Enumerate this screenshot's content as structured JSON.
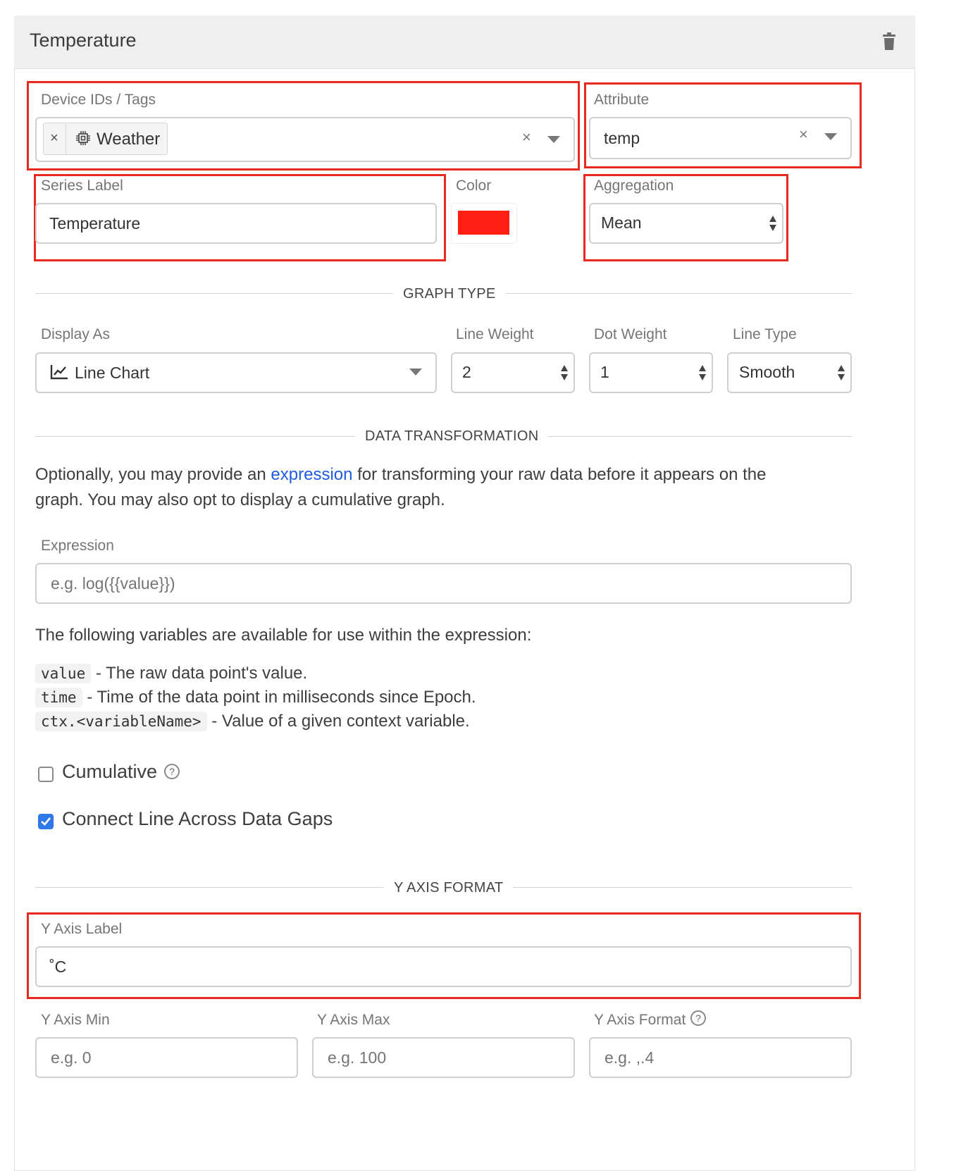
{
  "panel": {
    "title": "Temperature"
  },
  "fields": {
    "device": {
      "label": "Device IDs / Tags",
      "tag": "Weather"
    },
    "attribute": {
      "label": "Attribute",
      "value": "temp"
    },
    "series_label": {
      "label": "Series Label",
      "value": "Temperature"
    },
    "color": {
      "label": "Color",
      "value": "#ff1e12"
    },
    "aggregation": {
      "label": "Aggregation",
      "value": "Mean"
    }
  },
  "graph_type": {
    "title": "GRAPH TYPE",
    "display_as": {
      "label": "Display As",
      "value": "Line Chart"
    },
    "line_weight": {
      "label": "Line Weight",
      "value": "2"
    },
    "dot_weight": {
      "label": "Dot Weight",
      "value": "1"
    },
    "line_type": {
      "label": "Line Type",
      "value": "Smooth"
    }
  },
  "data_transformation": {
    "title": "DATA TRANSFORMATION",
    "intro_before": "Optionally, you may provide an ",
    "intro_link": "expression",
    "intro_after": " for transforming your raw data before it appears on the",
    "intro_line2": "graph. You may also opt to display a cumulative graph.",
    "expression": {
      "label": "Expression",
      "placeholder": "e.g. log({{value}})"
    },
    "vars_intro": "The following variables are available for use within the expression:",
    "vars": [
      {
        "code": "value",
        "desc": "- The raw data point's value."
      },
      {
        "code": "time",
        "desc": "- Time of the data point in milliseconds since Epoch."
      },
      {
        "code": "ctx.<variableName>",
        "desc": "- Value of a given context variable."
      }
    ],
    "cumulative": {
      "label": "Cumulative",
      "checked": false
    },
    "connect_gaps": {
      "label": "Connect Line Across Data Gaps",
      "checked": true
    }
  },
  "y_axis": {
    "title": "Y AXIS FORMAT",
    "label": {
      "label": "Y Axis Label",
      "value": "˚C"
    },
    "min": {
      "label": "Y Axis Min",
      "placeholder": "e.g. 0"
    },
    "max": {
      "label": "Y Axis Max",
      "placeholder": "e.g. 100"
    },
    "format": {
      "label": "Y Axis Format",
      "placeholder": "e.g. ,.4"
    }
  },
  "colors": {
    "highlight": "#e62b1e",
    "link": "#1f5ce0",
    "checkbox": "#2f78e8"
  }
}
